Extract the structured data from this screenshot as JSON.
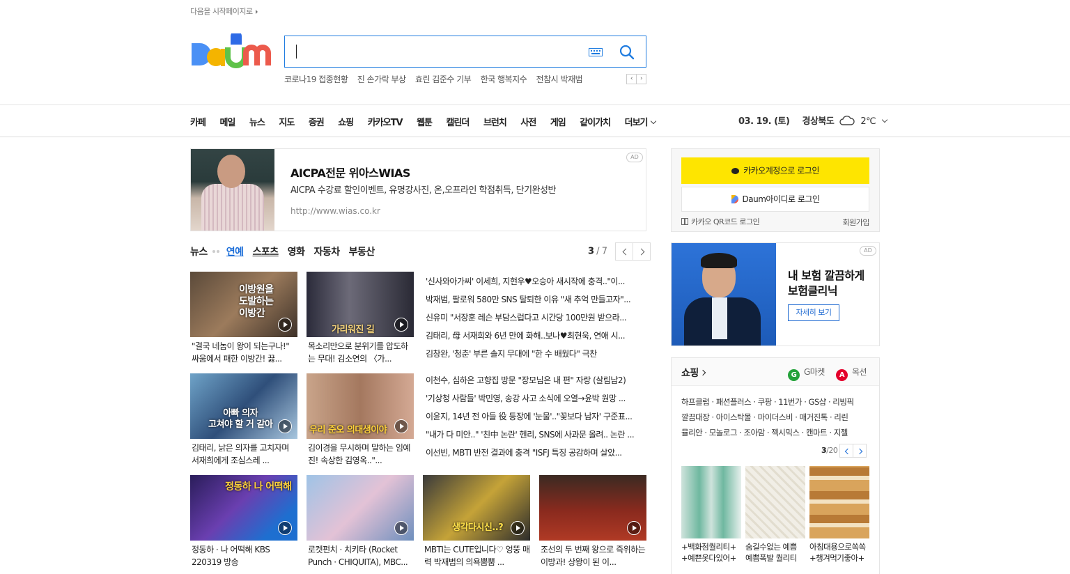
{
  "top": {
    "start_page": "다음을 시작페이지로"
  },
  "search": {
    "value": "",
    "trending": [
      "코로나19 접종현황",
      "진 손가락 부상",
      "효린 김준수 기부",
      "한국 행복지수",
      "전참시 박재범"
    ]
  },
  "nav": {
    "items": [
      "카페",
      "메일",
      "뉴스",
      "지도",
      "증권",
      "쇼핑",
      "카카오TV",
      "웹툰",
      "캘린더",
      "브런치",
      "사전",
      "게임",
      "같이가치"
    ],
    "more": "더보기"
  },
  "weather": {
    "date": "03. 19. (토)",
    "region": "경상북도",
    "temp": "2℃"
  },
  "ad_banner": {
    "badge": "AD",
    "title": "AICPA전문 위아스WIAS",
    "desc": "AICPA 수강료 할인이벤트, 유명강사진, 온,오프라인 학점취득, 단기완성반",
    "url": "http://www.wias.co.kr"
  },
  "news": {
    "tabs": [
      "뉴스",
      "연예",
      "스포츠",
      "영화",
      "자동차",
      "부동산"
    ],
    "active_tab": "연예",
    "page_current": "3",
    "page_total": " / 7",
    "thumbs": [
      {
        "overlay": "이방원을\n도발하는\n이방간",
        "caption": "\"결국 네놈이 왕이 되는구나!\" 싸움에서 패한 이방간! 끓..."
      },
      {
        "overlay": "가리워진 길",
        "caption": "목소리만으로 분위기를 압도하는 무대! 김소연의 〈가..."
      },
      {
        "overlay": "아빠 의자\n고쳐야 할 거 같아",
        "caption": "김태리, 낡은 의자를 고치자며 서재희에게 조심스레 ..."
      },
      {
        "overlay": "우리 준오 의대생이야",
        "caption": "김이경을 무시하며 말하는 임예진! 속상한 김영옥..\"..."
      },
      {
        "overlay": "정동하 나 어떡해",
        "caption": "정동하 · 나 어떡해 KBS 220319 방송"
      },
      {
        "overlay": "",
        "caption": "로켓펀치 · 치키타 (Rocket Punch · CHIQUITA), MBC..."
      },
      {
        "overlay": "생각다시신..?",
        "caption": "MBTI는 CUTE입니다♡ 엉뚱 매력 박재범의 의욕뿜뿜 ..."
      },
      {
        "overlay": "",
        "caption": "조선의 두 번째 왕으로 즉위하는 이방과! 상왕이 된 이..."
      }
    ],
    "headlines_1": [
      "'신사와아가씨' 이세희, 지현우♥오승아 새시작에 충격..\"이...",
      "박재범, 팔로워 580만 SNS 탈퇴한 이유 \"새 추억 만들고자\"...",
      "신유미 \"서장훈 레슨 부담스럽다고 시간당 100만원 받으라...",
      "김태리, 母 서재희와 6년 만에 화해..보나♥최현욱, 연애 시...",
      "김창완, '청춘' 부른 솔지 무대에 \"한 수 배웠다\" 극찬"
    ],
    "headlines_2": [
      "이천수, 심하은 고향집 방문 \"장모님은 내 편\" 자랑 (살림남2)",
      "'기상청 사람들' 박민영, 송강 사고 소식에 오열→윤박 원망 ...",
      "이윤지, 14년 전 아들 役 등장에 '눈물'..\"꽃보다 남자' 구준표...",
      "\"내가 다 미안..\" '친中 논란' 헨리, SNS에 사과문 올려.. 논란 ...",
      "이선빈, MBTI 반전 결과에 충격 \"ISFJ 특징 공감하며 살았..."
    ]
  },
  "login": {
    "kakao": "카카오계정으로 로그인",
    "daum": "Daum아이디로 로그인",
    "qr": "카카오 QR코드 로그인",
    "signup": "회원가입"
  },
  "ad_side": {
    "badge": "AD",
    "title": "내 보험 깔끔하게 보험클리닉",
    "more": "자세히 보기"
  },
  "shopping": {
    "title": "쇼핑",
    "gmarket": "G마켓",
    "auction": "옥션",
    "links": [
      "하프클럽 · 패션플러스 · 쿠팡 · 11번가 · GS샵 · 리빙픽",
      "깔끔대장 · 아이스탁몰 · 마이더스비 · 매거진톡 · 리린",
      "뮬리안 · 모놀로그 · 조아맘 · 젝시믹스 · 캔마트 · 지젤"
    ],
    "page_current": "3",
    "page_total": "/20",
    "products": [
      {
        "name": "+백화점퀄리티+ +예쁜옷다있어+"
      },
      {
        "name": "숨길수없는 예쁨 예쁨폭발 퀄리티"
      },
      {
        "name": "아침대용으로쏙쏙 +챙겨먹기좋아+"
      }
    ]
  },
  "colors": {
    "accent": "#1f7ce0",
    "kakao": "#fee500",
    "active_tab": "#1b6dd8"
  }
}
